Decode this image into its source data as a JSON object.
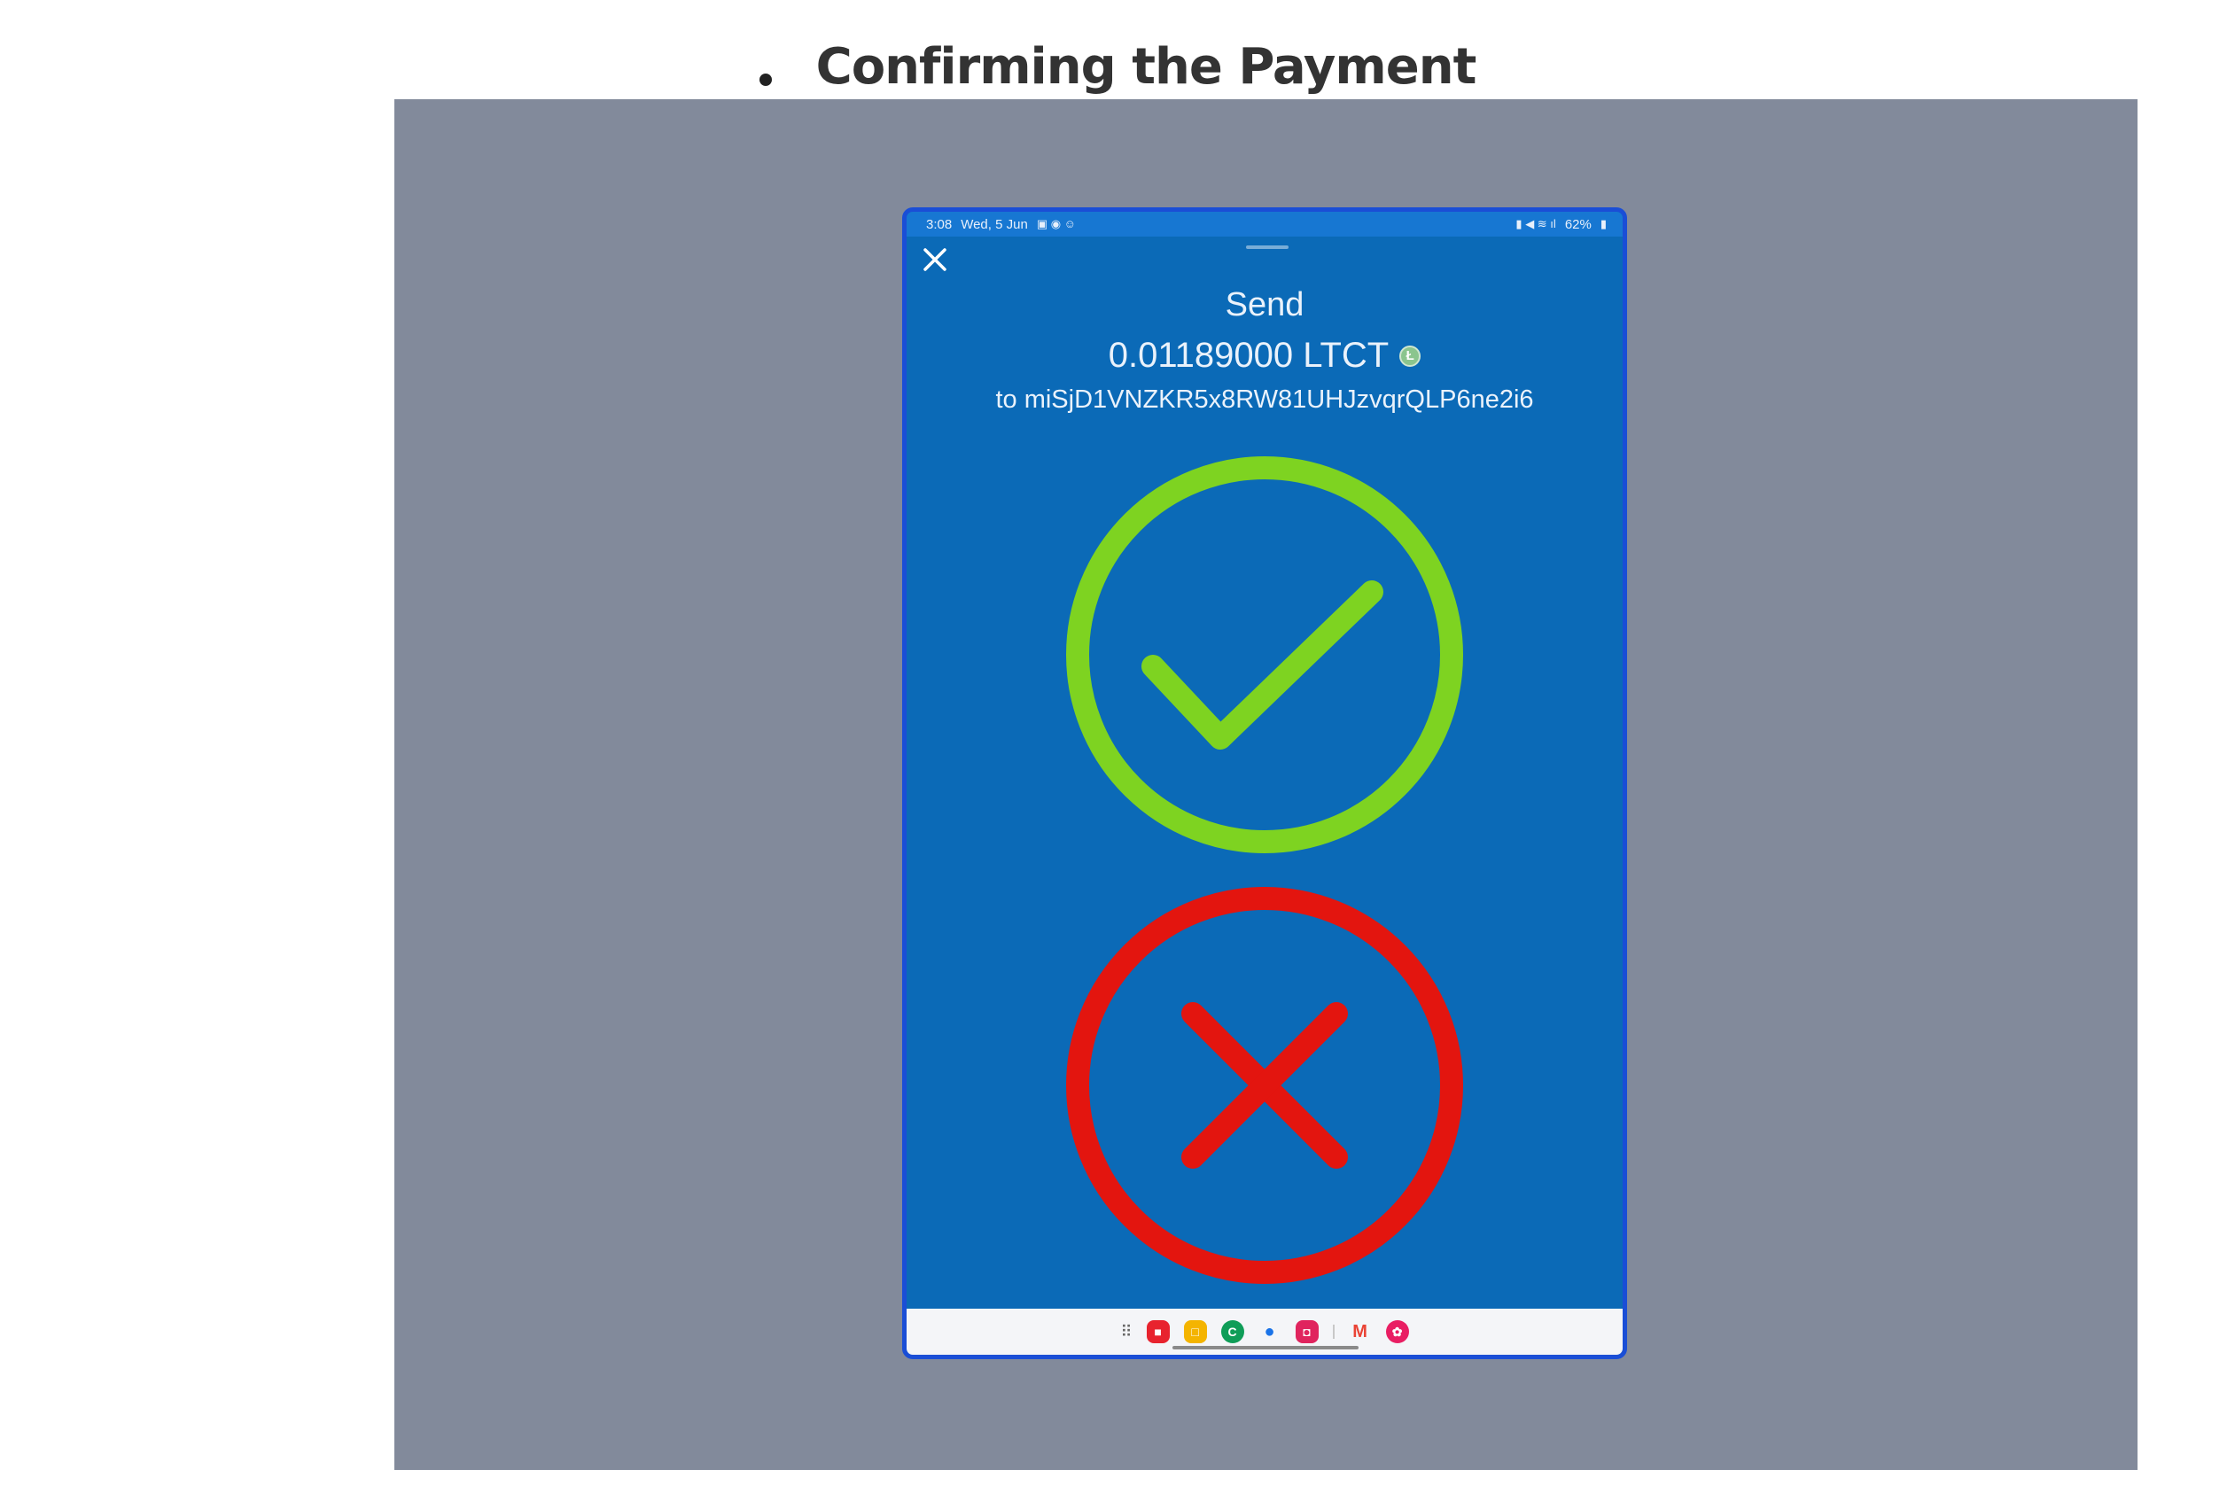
{
  "heading": {
    "title": "Confirming the Payment"
  },
  "device": {
    "status_bar": {
      "time": "3:08",
      "date": "Wed, 5 Jun",
      "battery": "62%"
    },
    "send": {
      "label": "Send",
      "amount": "0.01189000 LTCT",
      "coin_icon": "litecoin-icon",
      "recipient": "to miSjD1VNZKR5x8RW81UHJzvqrQLP6ne2i6"
    },
    "actions": {
      "confirm_icon": "checkmark-circle-icon",
      "cancel_icon": "x-circle-icon"
    },
    "colors": {
      "screen_bg": "#0b6ab7",
      "confirm": "#7ed321",
      "cancel": "#e3150f",
      "frame": "#1a4ed6",
      "panel": "#828a9b"
    },
    "taskbar": {
      "apps": [
        {
          "name": "app-drawer-icon"
        },
        {
          "name": "red-app-icon",
          "color": "#e8232e"
        },
        {
          "name": "yellow-app-icon",
          "color": "#f4b400"
        },
        {
          "name": "green-app-icon",
          "color": "#0f9d58"
        },
        {
          "name": "messages-icon",
          "color": "#1a73e8"
        },
        {
          "name": "camera-app-icon",
          "color": "#e0245e"
        },
        {
          "name": "gmail-icon",
          "color": "#ea4335"
        },
        {
          "name": "flower-app-icon",
          "color": "#e91e63"
        }
      ]
    }
  }
}
